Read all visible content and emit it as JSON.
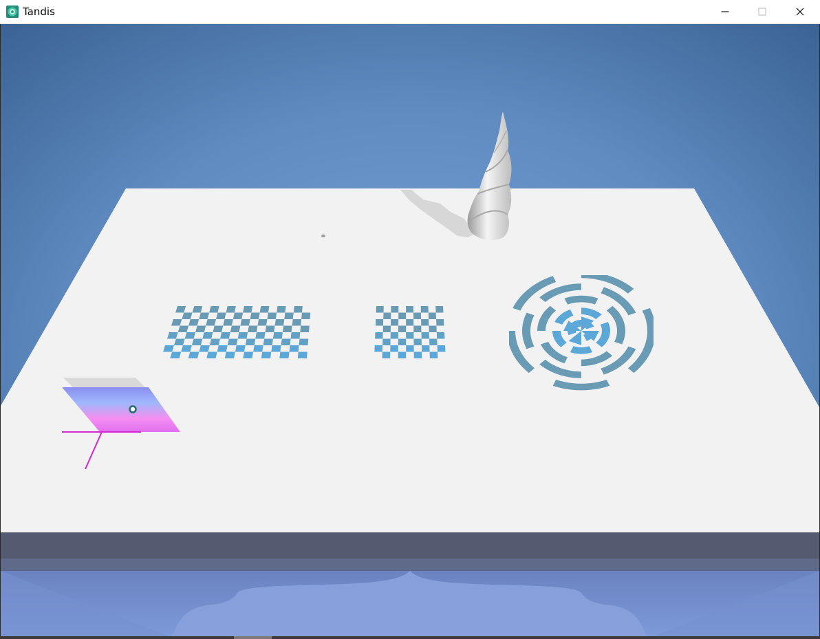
{
  "window": {
    "title": "Tandis",
    "icon": "tandis-app-icon"
  },
  "controls": {
    "minimize_icon": "minimize-icon",
    "maximize_icon": "maximize-icon",
    "close_icon": "close-icon"
  },
  "colors": {
    "sky_top": "#3d6694",
    "sky_mid": "#6b97cb",
    "table_top": "#f2f2f2",
    "pattern_dark": "#6a9bb4",
    "pattern_light": "#5aa7d8",
    "slanted_grad_top": "#8fa0f0",
    "slanted_grad_bottom": "#ff88ee",
    "axis_line": "#d020d0",
    "floor_shadow": "#545c72",
    "floor_reflection": "#7f9ad6"
  },
  "scene": {
    "objects": [
      "table-top",
      "spiral-horn-sculpture",
      "large-checkerboard",
      "small-checkerboard",
      "radial-target-pattern",
      "gradient-parallelogram",
      "axis-gizmo"
    ]
  }
}
